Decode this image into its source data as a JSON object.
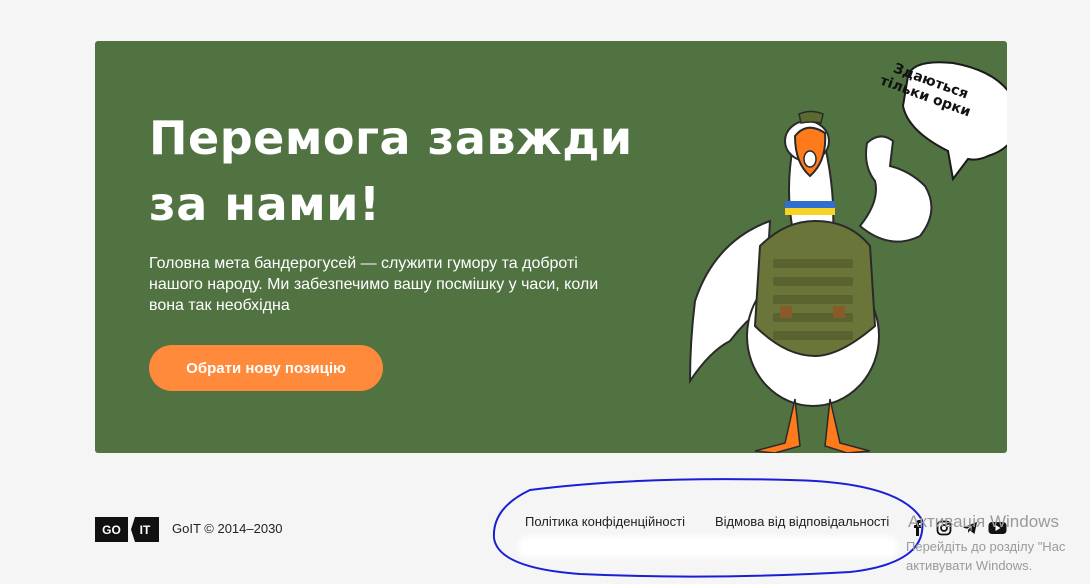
{
  "hero": {
    "title_line1": "Перемога завжди",
    "title_line2": "за нами!",
    "description": "Головна мета бандерогусей — служити гумору та доброті нашого народу. Ми забезпечимо вашу посмішку у часи, коли вона так необхідна",
    "cta_label": "Обрати нову позицію",
    "bubble_line1": "Здаються",
    "bubble_line2": "тільки орки"
  },
  "footer": {
    "logo_left": "GO",
    "logo_right": "IT",
    "copyright": "GoIT © 2014–2030",
    "links": [
      "Політика конфіденційності",
      "Відмова від відповідальності"
    ],
    "social_icons": [
      "facebook-icon",
      "instagram-icon",
      "telegram-icon",
      "youtube-icon"
    ]
  },
  "watermark": {
    "title": "Активація Windows",
    "line1": "Перейдіть до розділу \"Нас",
    "line2": "активувати Windows."
  },
  "colors": {
    "hero_bg": "#517342",
    "accent": "#ff8a3c",
    "annotation": "#1a1fd6"
  }
}
